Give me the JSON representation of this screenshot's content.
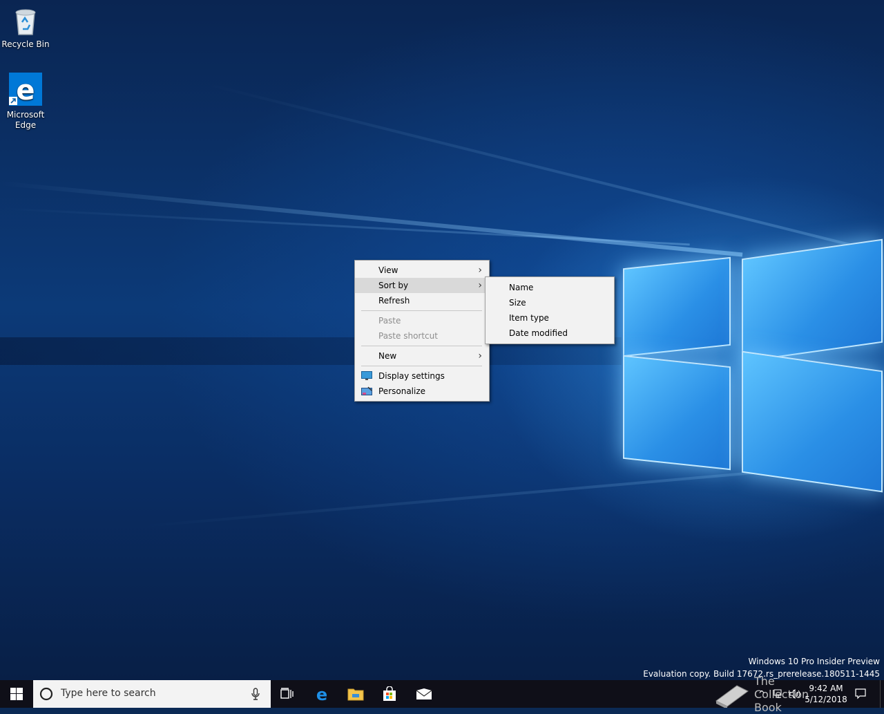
{
  "desktop": {
    "icons": [
      {
        "label": "Recycle Bin",
        "icon": "recycle-bin-icon"
      },
      {
        "label": "Microsoft\nEdge",
        "label_line1": "Microsoft",
        "label_line2": "Edge",
        "icon": "edge-icon"
      }
    ],
    "watermark": {
      "line1": "Windows 10 Pro Insider Preview",
      "line2": "Evaluation copy. Build 17672.rs_prerelease.180511-1445"
    }
  },
  "context_menu": {
    "items": [
      {
        "label": "View",
        "submenu": true
      },
      {
        "label": "Sort by",
        "submenu": true,
        "highlighted": true
      },
      {
        "label": "Refresh"
      },
      {
        "label": "Paste",
        "disabled": true
      },
      {
        "label": "Paste shortcut",
        "disabled": true
      },
      {
        "label": "New",
        "submenu": true
      },
      {
        "label": "Display settings",
        "icon": "display-settings-icon"
      },
      {
        "label": "Personalize",
        "icon": "personalize-icon"
      }
    ],
    "arrow_glyph": "›"
  },
  "sort_submenu": {
    "items": [
      {
        "label": "Name"
      },
      {
        "label": "Size"
      },
      {
        "label": "Item type"
      },
      {
        "label": "Date modified"
      }
    ]
  },
  "taskbar": {
    "search_placeholder": "Type here to search",
    "pinned": [
      "task-view-icon",
      "edge-icon",
      "file-explorer-icon",
      "store-icon",
      "mail-icon"
    ],
    "clock": {
      "time": "9:42 AM",
      "date": "5/12/2018"
    },
    "overlay_text": "The Collection Book"
  },
  "colors": {
    "taskbar": "#0f0f18",
    "menu_bg": "#f2f2f2",
    "menu_highlight": "#d9d9d9",
    "accent": "#0078d7"
  }
}
